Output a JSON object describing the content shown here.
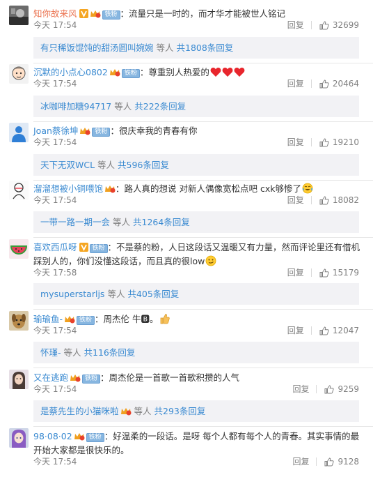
{
  "actions": {
    "reply_label": "回复",
    "others_label": "等人"
  },
  "badges": {
    "fan_label": "铁粉"
  },
  "comments": [
    {
      "user": "知你故来风",
      "text": "：流量只是一时的，而才华才能被世人铭记",
      "time": "今天 17:54",
      "likes": "32699",
      "sub_user": "有只稀饭馄饨的甜汤圆叫婉婉",
      "sub_total": "共1808条回复",
      "avatar_icon": "photo-avatar-icon"
    },
    {
      "user": "沉默的小点心0802",
      "text": "：尊重别人热爱的",
      "time": "今天 17:54",
      "likes": "20464",
      "sub_user": "冰咖啡加糖94717",
      "sub_total": "共222条回复",
      "avatar_icon": "cartoon-avatar-icon",
      "emoji": [
        "heart-emoji",
        "heart-emoji",
        "heart-emoji"
      ]
    },
    {
      "user": "Joan蔡徐坤",
      "text": "：很庆幸我的青春有你",
      "time": "今天 17:54",
      "likes": "19210",
      "sub_user": "天下无双WCL",
      "sub_total": "共596条回复",
      "avatar_icon": "blue-figure-avatar-icon"
    },
    {
      "user": "溜溜想被小铜喂饱",
      "text": "：路人真的想说 对新人偶像宽松点吧 cxk够惨了",
      "time": "今天 17:54",
      "likes": "18082",
      "sub_user": "一带一路一期一会",
      "sub_total": "共1264条回复",
      "avatar_icon": "sketch-avatar-icon",
      "emoji": [
        "crying-laugh-emoji"
      ]
    },
    {
      "user": "喜欢西瓜呀",
      "text": "：不是蔡的粉，人日这段话又温暖又有力量，然而评论里还有借机踩别人的，你们没懂这段话，而且真的很low",
      "time": "今天 17:58",
      "likes": "15179",
      "sub_user": "mysuperstarljs",
      "sub_total": "共405条回复",
      "avatar_icon": "watermelon-avatar-icon",
      "emoji": [
        "smirk-emoji"
      ]
    },
    {
      "user": "瑜瑜鱼-",
      "text": "：周杰伦  牛🅱。",
      "time": "今天 17:54",
      "likes": "12047",
      "sub_user": "怀瑾-",
      "sub_total": "共116条回复",
      "avatar_icon": "dog-avatar-icon",
      "emoji": [
        "thumbs-up-emoji"
      ]
    },
    {
      "user": "又在逃跑",
      "text": "：周杰伦是一首歌一首歌积攒的人气",
      "time": "今天 17:54",
      "likes": "9259",
      "sub_user": "是蔡先生的小猫咪啦",
      "sub_total": "共293条回复",
      "avatar_icon": "girl-avatar-icon"
    },
    {
      "user": "98·08·02",
      "text": "：好温柔的一段话。是呀 每个人都有每个人的青春。其实事情的最开始大家都是很快乐的。",
      "time": "今天 17:54",
      "likes": "9128",
      "avatar_icon": "anime-avatar-icon"
    }
  ]
}
